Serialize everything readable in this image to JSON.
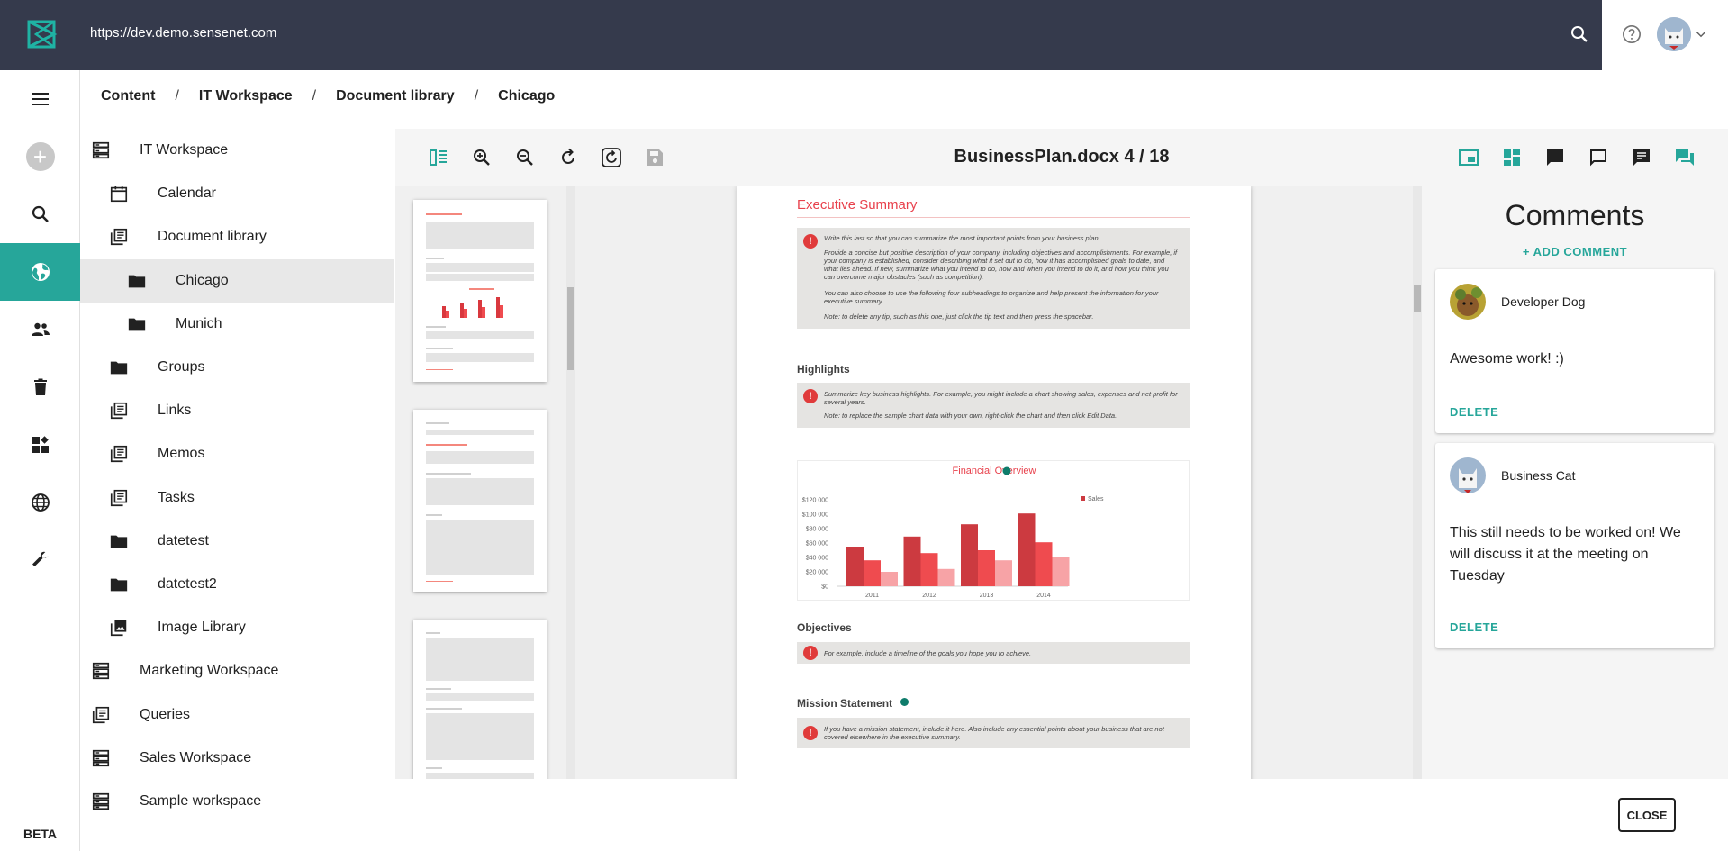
{
  "header": {
    "url": "https://dev.demo.sensenet.com"
  },
  "rail": {
    "beta_label": "BETA"
  },
  "breadcrumb": [
    "Content",
    "IT Workspace",
    "Document library",
    "Chicago"
  ],
  "tree": [
    {
      "label": "IT Workspace",
      "icon": "workspace-icon"
    },
    {
      "label": "Calendar",
      "icon": "calendar-icon"
    },
    {
      "label": "Document library",
      "icon": "library-icon"
    },
    {
      "label": "Chicago",
      "icon": "folder-icon",
      "selected": true
    },
    {
      "label": "Munich",
      "icon": "folder-icon"
    },
    {
      "label": "Groups",
      "icon": "folder-icon"
    },
    {
      "label": "Links",
      "icon": "library-icon"
    },
    {
      "label": "Memos",
      "icon": "library-icon"
    },
    {
      "label": "Tasks",
      "icon": "library-icon"
    },
    {
      "label": "datetest",
      "icon": "folder-icon"
    },
    {
      "label": "datetest2",
      "icon": "folder-icon"
    },
    {
      "label": "Image Library",
      "icon": "image-library-icon"
    },
    {
      "label": "Marketing Workspace",
      "icon": "workspace-icon"
    },
    {
      "label": "Queries",
      "icon": "library-icon"
    },
    {
      "label": "Sales Workspace",
      "icon": "workspace-icon"
    },
    {
      "label": "Sample workspace",
      "icon": "workspace-icon"
    }
  ],
  "viewer": {
    "title": "BusinessPlan.docx 4 / 18",
    "accent": "#26a69a"
  },
  "document": {
    "heading": "Executive Summary",
    "tip1": [
      "Write this last so that you can summarize the most important points from your business plan.",
      "Provide a concise but positive description of your company, including objectives and accomplishments. For example, if your company is established, consider describing what it set out to do, how it has accomplished goals to date, and what lies ahead. If new, summarize what you intend to do, how and when you intend to do it, and how you think you can overcome major obstacles (such as competition).",
      "You can also choose to use the following four subheadings to organize and help present the information for your executive summary.",
      "Note: to delete any tip, such as this one, just click the tip text and then press the spacebar."
    ],
    "highlights_heading": "Highlights",
    "tip2": [
      "Summarize key business highlights. For example, you might include a chart showing sales, expenses and net profit for several years.",
      "Note: to replace the sample chart data with your own, right-click the chart and then click Edit Data."
    ],
    "objectives_heading": "Objectives",
    "tip3": "For example, include a timeline of the goals you hope you to achieve.",
    "mission_heading": "Mission Statement",
    "tip4": "If you have a mission statement, include it here. Also include any essential points about your business that are not covered elsewhere in the executive summary."
  },
  "chart_data": {
    "type": "bar",
    "title": "Financial Overview",
    "categories": [
      "2011",
      "2012",
      "2013",
      "2014"
    ],
    "series": [
      {
        "name": "Sales",
        "values": [
          55000,
          69000,
          86000,
          101000
        ],
        "color": "#cc3a40"
      },
      {
        "values": [
          36000,
          46000,
          50000,
          61000
        ],
        "color": "#ef4b4f"
      },
      {
        "values": [
          20000,
          24000,
          36000,
          41000
        ],
        "color": "#f7a3a6"
      }
    ],
    "ylim": [
      0,
      120000
    ],
    "yticks": [
      "$120 000",
      "$100 000",
      "$80 000",
      "$60 000",
      "$40 000",
      "$20 000",
      "$0"
    ],
    "legend": "right"
  },
  "comments": {
    "title": "Comments",
    "add_label": "+ ADD COMMENT",
    "items": [
      {
        "author": "Developer Dog",
        "text": "Awesome work! :)",
        "delete_label": "DELETE"
      },
      {
        "author": "Business Cat",
        "text": "This still needs to be worked on! We will discuss it at the meeting on Tuesday",
        "delete_label": "DELETE"
      }
    ]
  },
  "close_label": "CLOSE"
}
